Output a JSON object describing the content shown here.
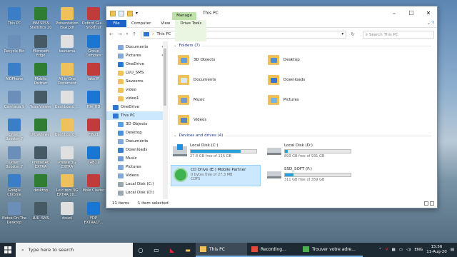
{
  "desktop": {
    "icons": [
      {
        "label": "This PC"
      },
      {
        "label": "IBM SPSS Statistics 20"
      },
      {
        "label": "Présentation ISGI.pdf"
      },
      {
        "label": "Oxford_Gla... Shortcut"
      },
      {
        "label": "Recycle Bin"
      },
      {
        "label": "Microsoft Edge"
      },
      {
        "label": "kasvama"
      },
      {
        "label": "Group Compare"
      },
      {
        "label": "AIOPhone"
      },
      {
        "label": "Mobile Partner"
      },
      {
        "label": "All in One Document"
      },
      {
        "label": "lake IP"
      },
      {
        "label": "Camtasia 9"
      },
      {
        "label": "TeamViewer"
      },
      {
        "label": "Dashboard_..."
      },
      {
        "label": "File_HD"
      },
      {
        "label": "Driver Booster 7"
      },
      {
        "label": "UltraViewer"
      },
      {
        "label": "Dashboard_..."
      },
      {
        "label": "FIN21"
      },
      {
        "label": "Driver Booster 7"
      },
      {
        "label": "Presse 40 EXTRA"
      },
      {
        "label": "Presse 3G EXTRA"
      },
      {
        "label": "TAB11"
      },
      {
        "label": "Google Chrome"
      },
      {
        "label": "desktop"
      },
      {
        "label": "Le c rem 3G EXTRA 10..."
      },
      {
        "label": "Mole Clavier"
      },
      {
        "label": "Notes On The Desktop"
      },
      {
        "label": "LUU_SMS"
      },
      {
        "label": "douni"
      },
      {
        "label": "FDP EXTRACT..."
      }
    ]
  },
  "window": {
    "title": "This PC",
    "manage_tab": "Manage",
    "ribbon": {
      "file": "File",
      "computer": "Computer",
      "view": "View",
      "drive_tools": "Drive Tools"
    },
    "address": {
      "path": "This PC",
      "search_placeholder": "Search This PC"
    },
    "nav_items": [
      {
        "label": "Documents",
        "pinned": true,
        "color": "#7fa7d9"
      },
      {
        "label": "Pictures",
        "pinned": true,
        "color": "#7fa7d9"
      },
      {
        "label": "OneDrive",
        "pinned": false,
        "color": "#2b78d0"
      },
      {
        "label": "LUU_SMS",
        "pinned": false,
        "color": "#f0c15a"
      },
      {
        "label": "Savesms",
        "pinned": false,
        "color": "#f0c15a"
      },
      {
        "label": "video",
        "pinned": false,
        "color": "#f0c15a"
      },
      {
        "label": "video1",
        "pinned": false,
        "color": "#f0c15a"
      }
    ],
    "nav_onedrive": "OneDrive",
    "nav_thispc": "This PC",
    "nav_sub": [
      {
        "label": "3D Objects",
        "color": "#5aa0e0"
      },
      {
        "label": "Desktop",
        "color": "#4f8fd6"
      },
      {
        "label": "Documents",
        "color": "#7fa7d9"
      },
      {
        "label": "Downloads",
        "color": "#3a7ec7"
      },
      {
        "label": "Music",
        "color": "#6d9ad4"
      },
      {
        "label": "Pictures",
        "color": "#7fa7d9"
      },
      {
        "label": "Videos",
        "color": "#7fa7d9"
      },
      {
        "label": "Local Disk (C:)",
        "color": "#9aa7b1"
      },
      {
        "label": "Local Disk (D:)",
        "color": "#9aa7b1"
      }
    ],
    "folders_header": "Folders (7)",
    "folders": [
      {
        "label": "3D Objects",
        "overlay": "#5aa0e0"
      },
      {
        "label": "Desktop",
        "overlay": "#4f8fd6"
      },
      {
        "label": "Documents",
        "overlay": "#d8e6f5"
      },
      {
        "label": "Downloads",
        "overlay": "#2e7bd1"
      },
      {
        "label": "Music",
        "overlay": "#6d9ad4"
      },
      {
        "label": "Pictures",
        "overlay": "#74b2e8"
      },
      {
        "label": "Videos",
        "overlay": "#5a86c4"
      }
    ],
    "drives_header": "Devices and drives (4)",
    "drives": [
      {
        "name": "Local Disk (C:)",
        "free": "27.8 GB free of 116 GB",
        "used_fraction": 0.76,
        "type": "win",
        "selected": false
      },
      {
        "name": "Local Disk (D:)",
        "free": "893 GB free of 931 GB",
        "used_fraction": 0.04,
        "type": "hdd",
        "selected": false
      },
      {
        "name": "CD Drive (E:) Mobile Partner",
        "free": "0 bytes free of 27.3 MB",
        "fs": "CDFS",
        "type": "cd",
        "selected": true
      },
      {
        "name": "SSD_SOFT (F:)",
        "free": "311 GB free of 359 GB",
        "used_fraction": 0.13,
        "type": "hdd",
        "selected": false
      }
    ],
    "status": {
      "items": "11 items",
      "selected": "1 item selected"
    }
  },
  "taskbar": {
    "search_placeholder": "Type here to search",
    "apps": [
      {
        "label": "This PC",
        "active": true
      },
      {
        "label": "Recording...",
        "active": false
      },
      {
        "label": "Trouver votre adre...",
        "active": false
      }
    ],
    "lang": "ENG",
    "time": "15:56",
    "date": "11-Aug-20"
  },
  "colors": {
    "accent": "#1f63c8",
    "selection": "#cce8ff",
    "progress": "#26a0da",
    "manage_tab": "#bde1a8"
  }
}
